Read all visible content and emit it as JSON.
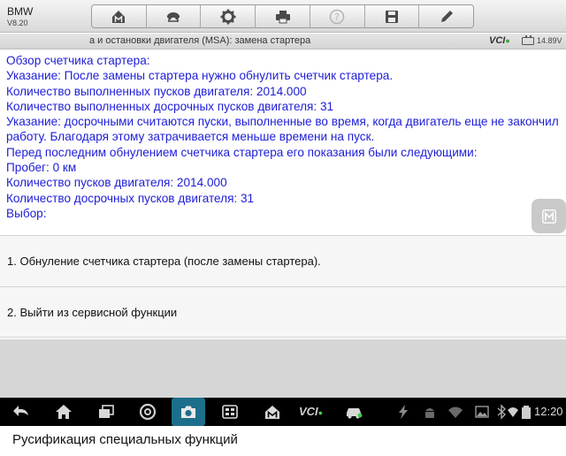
{
  "app": {
    "name": "BMW",
    "version": "V8.20"
  },
  "toolbar": {
    "buttons": [
      {
        "icon": "home-icon"
      },
      {
        "icon": "car-lift-icon"
      },
      {
        "icon": "settings-gear-icon"
      },
      {
        "icon": "printer-icon"
      },
      {
        "icon": "help-icon"
      },
      {
        "icon": "save-icon"
      },
      {
        "icon": "pencil-icon"
      }
    ]
  },
  "status": {
    "title": "а и остановки двигателя (MSA): замена стартера",
    "vci_label": "VCI",
    "voltage": "14.89V"
  },
  "info_lines": [
    "Обзор счетчика стартера:",
    "Указание: После замены стартера нужно обнулить счетчик стартера.",
    "Количество выполненных пусков двигателя: 2014.000",
    "Количество выполненных досрочных пусков двигателя: 31",
    "Указание: досрочными считаются пуски, выполненные во время, когда двигатель еще не закончил работу. Благодаря этому затрачивается меньше времени на пуск.",
    "Перед последним обнулением счетчика стартера его показания были следующими:",
    "Пробег: 0 км",
    "Количество пусков двигателя: 2014.000",
    "Количество досрочных пусков двигателя: 31",
    "Выбор:"
  ],
  "options": [
    {
      "label": "1. Обнуление счетчика стартера (после замены стартера)."
    },
    {
      "label": "2. Выйти из сервисной функции"
    }
  ],
  "navbar": {
    "vci_label": "VCI",
    "time": "12:20"
  },
  "caption": "Русификация специальных функций",
  "colors": {
    "info_text": "#1d1dd8",
    "navbar_bg": "#000000",
    "camera_highlight": "#1c6f8a",
    "vci_connected": "#46c646"
  }
}
